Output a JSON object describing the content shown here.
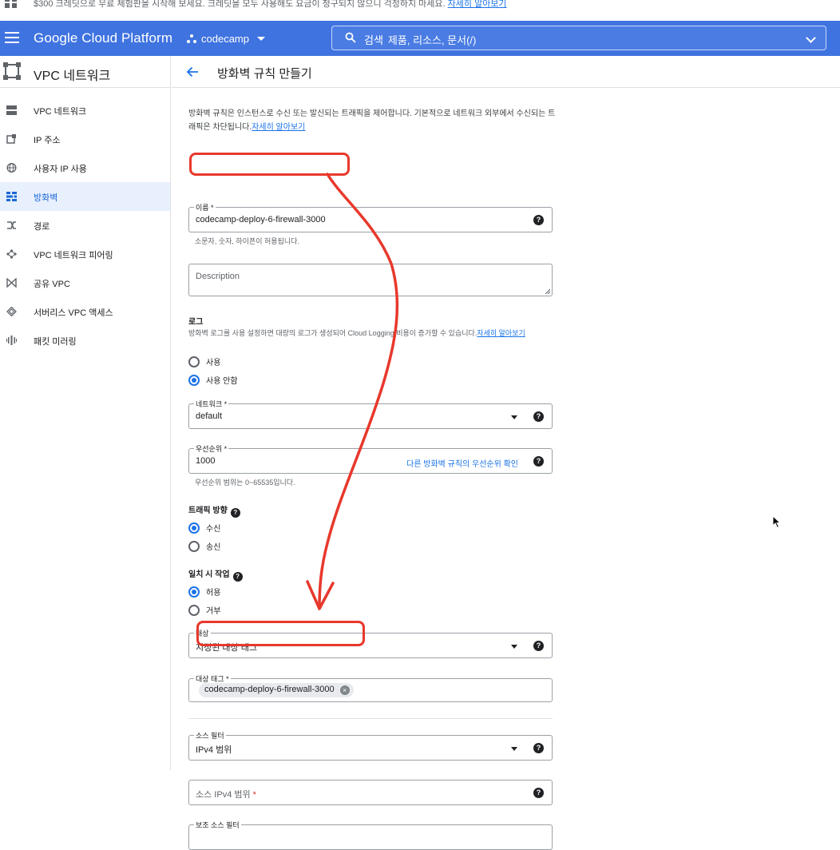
{
  "notice": {
    "text": "$300 크레딧으로 무료 체험판을 시작해 보세요. 크레딧을 모두 사용해도 요금이 청구되지 않으니 걱정하지 마세요.",
    "link": "자세히 알아보기"
  },
  "topbar": {
    "brand": "Google Cloud Platform",
    "project": "codecamp",
    "search_label": "검색",
    "search_hint": "제품, 리소스, 문서(/)"
  },
  "sidebar": {
    "title": "VPC 네트워크",
    "items": [
      {
        "label": "VPC 네트워크",
        "icon": "vpc-network-icon"
      },
      {
        "label": "IP 주소",
        "icon": "ip-address-icon"
      },
      {
        "label": "사용자 IP 사용",
        "icon": "globe-icon"
      },
      {
        "label": "방화벽",
        "icon": "firewall-icon"
      },
      {
        "label": "경로",
        "icon": "routes-icon"
      },
      {
        "label": "VPC 네트워크 피어링",
        "icon": "peering-icon"
      },
      {
        "label": "공유 VPC",
        "icon": "shared-vpc-icon"
      },
      {
        "label": "서버리스 VPC 액세스",
        "icon": "serverless-icon"
      },
      {
        "label": "패킷 미러링",
        "icon": "packet-mirroring-icon"
      }
    ]
  },
  "page": {
    "title": "방화벽 규칙 만들기",
    "intro": "방화벽 규칙은 인스턴스로 수신 또는 발신되는 트래픽을 제어합니다. 기본적으로 네트워크 외부에서 수신되는 트래픽은 차단됩니다.",
    "intro_link": "자세히 알아보기"
  },
  "form": {
    "name_label": "이름 *",
    "name_value": "codecamp-deploy-6-firewall-3000",
    "name_hint": "소문자, 숫자, 하이픈이 허용됩니다.",
    "description_placeholder": "Description",
    "logs_title": "로그",
    "logs_desc": "방화벽 로그를 사용 설정하면 대량의 로그가 생성되어 Cloud Logging 비용이 증가할 수 있습니다.",
    "logs_link": "자세히 알아보기",
    "logs_on": "사용",
    "logs_off": "사용 안함",
    "network_label": "네트워크 *",
    "network_value": "default",
    "priority_label": "우선순위 *",
    "priority_value": "1000",
    "priority_link": "다른 방화벽 규칙의 우선순위 확인",
    "priority_hint": "우선순위 범위는 0~65535입니다.",
    "direction_title": "트래픽 방향",
    "direction_in": "수신",
    "direction_out": "송신",
    "action_title": "일치 시 작업",
    "action_allow": "허용",
    "action_deny": "거부",
    "target_label": "대상",
    "target_value": "지정된 대상 태그",
    "target_tags_label": "대상 태그 *",
    "target_tag_chip": "codecamp-deploy-6-firewall-3000",
    "source_filter_label": "소스 필터",
    "source_filter_value": "IPv4 범위",
    "source_ipv4_label": "소스 IPv4 범위",
    "source_ipv4_required": "*",
    "secondary_filter_label": "보조 소스 필터"
  },
  "colors": {
    "topbar": "#3f73e0",
    "accent": "#1a73e8",
    "annotation": "#e8382c"
  }
}
